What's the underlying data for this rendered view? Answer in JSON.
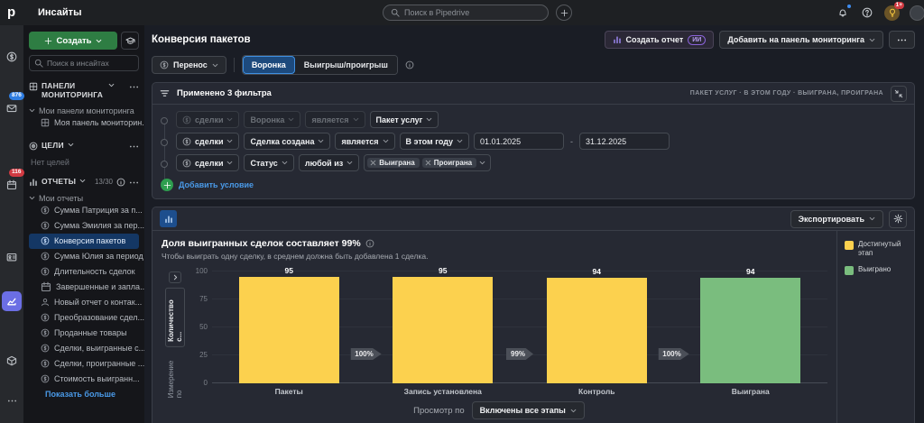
{
  "topbar": {
    "logo_letter": "p",
    "title": "Инсайты",
    "search_placeholder": "Поиск в Pipedrive",
    "mail_badge": "876",
    "calendar_badge": "116",
    "bulb_badge": "1+"
  },
  "sidebar": {
    "create_label": "Создать",
    "search_placeholder": "Поиск в инсайтах",
    "dashboards": {
      "title": "ПАНЕЛИ МОНИТОРИНГА",
      "group_label": "Мои панели мониторинга",
      "items": [
        "Моя панель мониторин..."
      ]
    },
    "goals": {
      "title": "ЦЕЛИ",
      "empty_label": "Нет целей"
    },
    "reports": {
      "title": "ОТЧЕТЫ",
      "count": "13/30",
      "group_label": "Мои отчеты",
      "items": [
        {
          "icon": "deal",
          "label": "Сумма Патриция за п...",
          "active": false
        },
        {
          "icon": "deal",
          "label": "Сумма Эмилия за пер...",
          "active": false
        },
        {
          "icon": "deal",
          "label": "Конверсия пакетов",
          "active": true
        },
        {
          "icon": "deal",
          "label": "Сумма Юлия за период",
          "active": false
        },
        {
          "icon": "deal",
          "label": "Длительность сделок",
          "active": false
        },
        {
          "icon": "calendar",
          "label": "Завершенные и запла...",
          "active": false
        },
        {
          "icon": "person",
          "label": "Новый отчет о контак...",
          "active": false
        },
        {
          "icon": "deal",
          "label": "Преобразование сдел...",
          "active": false
        },
        {
          "icon": "deal",
          "label": "Проданные товары",
          "active": false
        },
        {
          "icon": "deal",
          "label": "Сделки, выигранные с...",
          "active": false
        },
        {
          "icon": "deal",
          "label": "Сделки, проигранные ...",
          "active": false
        },
        {
          "icon": "deal",
          "label": "Стоимость выигранн...",
          "active": false
        }
      ],
      "show_more_label": "Показать больше"
    }
  },
  "header": {
    "page_title": "Конверсия пакетов",
    "create_report_label": "Создать отчет",
    "ai_badge": "ИИ",
    "add_to_dashboard_label": "Добавить на панель мониторинга"
  },
  "toolbar": {
    "transfer_label": "Перенос",
    "tabs": [
      {
        "label": "Воронка",
        "active": true
      },
      {
        "label": "Выигрыш/проигрыш",
        "active": false
      }
    ]
  },
  "filters": {
    "header": "Применено 3 фильтра",
    "summary": "ПАКЕТ УСЛУГ · В ЭТОМ ГОДУ · ВЫИГРАНА, ПРОИГРАНА",
    "add_condition_label": "Добавить условие",
    "rows": [
      {
        "controls": [
          {
            "type": "select",
            "label": "сделки",
            "icon": "deal",
            "dim": true
          },
          {
            "type": "select",
            "label": "Воронка",
            "dim": true
          },
          {
            "type": "select",
            "label": "является",
            "dim": true
          },
          {
            "type": "select",
            "label": "Пакет услуг"
          }
        ]
      },
      {
        "controls": [
          {
            "type": "select",
            "label": "сделки",
            "icon": "deal"
          },
          {
            "type": "select",
            "label": "Сделка создана"
          },
          {
            "type": "select",
            "label": "является"
          },
          {
            "type": "select",
            "label": "В этом году"
          },
          {
            "type": "input",
            "value": "01.01.2025"
          },
          {
            "type": "dash",
            "label": "-"
          },
          {
            "type": "input",
            "value": "31.12.2025"
          }
        ]
      },
      {
        "controls": [
          {
            "type": "select",
            "label": "сделки",
            "icon": "deal"
          },
          {
            "type": "select",
            "label": "Статус"
          },
          {
            "type": "select",
            "label": "любой из"
          },
          {
            "type": "chips",
            "chips": [
              "Выиграна",
              "Проиграна"
            ]
          }
        ]
      }
    ]
  },
  "report": {
    "insight_title": "Доля выигранных сделок составляет 99%",
    "insight_subtitle": "Чтобы выиграть одну сделку, в среднем должна быть добавлена 1 сделка.",
    "export_label": "Экспортировать",
    "measure_by_label": "Измерение по",
    "measure_value": "Количество с...",
    "view_by_label": "Просмотр по",
    "view_by_value": "Включены все этапы"
  },
  "chart_data": {
    "type": "bar",
    "title": "Доля выигранных сделок составляет 99%",
    "categories": [
      "Пакеты",
      "Запись установлена",
      "Контроль",
      "Выиграна"
    ],
    "values": [
      95,
      95,
      94,
      94
    ],
    "bar_colors": [
      "#fcd14e",
      "#fcd14e",
      "#fcd14e",
      "#7abd7e"
    ],
    "conversion_badges": [
      "100%",
      "99%",
      "100%"
    ],
    "yticks": [
      0,
      25,
      50,
      75,
      100
    ],
    "ylim": [
      0,
      100
    ],
    "grid": true,
    "ylabel": "Количество с...",
    "legend_position": "right",
    "legend": [
      {
        "label": "Достигнутый этап",
        "color": "#fcd14e"
      },
      {
        "label": "Выиграно",
        "color": "#7abd7e"
      }
    ]
  }
}
